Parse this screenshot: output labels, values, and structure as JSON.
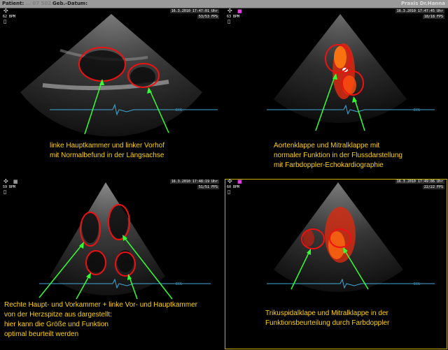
{
  "topbar": {
    "patient_label": "Patient:",
    "patient_value": "... 07 502",
    "dob_label": "Geb.-Datum:",
    "practice": "Praxis Dr.Hanna"
  },
  "panels": [
    {
      "timestamp": "16.3.2010 17:47:01 Uhr",
      "fps": "53/53 FPS",
      "bpm": "62 BPM",
      "ecg_label": "ECG",
      "caption": "linke Hauptkammer und linker Vorhof\nmit Normalbefund in der Längsachse"
    },
    {
      "timestamp": "16.3.2010 17:47:45 Uhr",
      "fps": "18/18 FPS",
      "bpm": "63 BPM",
      "ecg_label": "ECG",
      "caption": "Aortenklappe und Mitralklappe mit\nnormaler Funktion in der Flussdarstellung\nmit Farbdoppler-Echokardiographie"
    },
    {
      "timestamp": "16.3.2010 17:48:19 Uhr",
      "fps": "51/51 FPS",
      "bpm": "59 BPM",
      "ecg_label": "ECG",
      "caption": "Rechte Haupt- und Vorkammer + linke Vor- und Hauptkammer\nvon der Herzspitze aus dargestellt:\nhier kann die Größe und Funktion\noptimal beurteilt werden"
    },
    {
      "timestamp": "16.3.2010 17:49:06 Uhr",
      "fps": "22/22 FPS",
      "bpm": "60 BPM",
      "ecg_label": "ECG",
      "caption": "Trikuspidalklape  und Mitralklappe in der\nFunktionsbeurteilung durch Farbdoppler"
    }
  ],
  "colors": {
    "caption": "#ffd200",
    "arrow": "#33ff33",
    "annotation_circle": "#ee1111",
    "ecg_trace": "#3fa9d6",
    "selection_border": "#c8b400"
  }
}
